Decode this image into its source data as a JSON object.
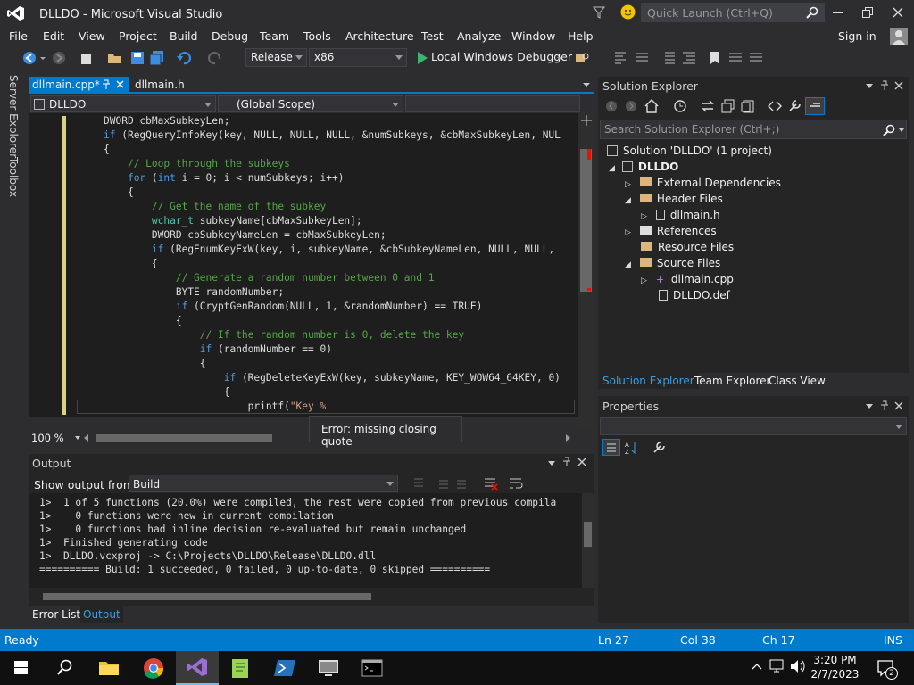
{
  "window": {
    "title": "DLLDO - Microsoft Visual Studio",
    "quick_launch_placeholder": "Quick Launch (Ctrl+Q)",
    "sign_in": "Sign in"
  },
  "menu": [
    "File",
    "Edit",
    "View",
    "Project",
    "Build",
    "Debug",
    "Team",
    "Tools",
    "Architecture",
    "Test",
    "Analyze",
    "Window",
    "Help"
  ],
  "toolbar": {
    "config": "Release",
    "platform": "x86",
    "debugger": "Local Windows Debugger"
  },
  "side_strip": [
    "Server Explorer",
    "Toolbox"
  ],
  "editor": {
    "tabs": [
      {
        "label": "dllmain.cpp*",
        "active": true
      },
      {
        "label": "dllmain.h",
        "active": false
      }
    ],
    "project_dropdown": "DLLDO",
    "scope_dropdown": "(Global Scope)",
    "zoom": "100 %",
    "tooltip": "Error: missing closing quote"
  },
  "code_lines": [
    "DWORD cbMaxSubkeyLen;",
    "if (RegQueryInfoKey(key, NULL, NULL, NULL, &numSubkeys, &cbMaxSubkeyLen, NUL",
    "{",
    "    // Loop through the subkeys",
    "    for (int i = 0; i < numSubkeys; i++)",
    "    {",
    "        // Get the name of the subkey",
    "        wchar_t subkeyName[cbMaxSubkeyLen];",
    "        DWORD cbSubkeyNameLen = cbMaxSubkeyLen;",
    "        if (RegEnumKeyExW(key, i, subkeyName, &cbSubkeyNameLen, NULL, NULL,",
    "        {",
    "            // Generate a random number between 0 and 1",
    "            BYTE randomNumber;",
    "            if (CryptGenRandom(NULL, 1, &randomNumber) == TRUE)",
    "            {",
    "                // If the random number is 0, delete the key",
    "                if (randomNumber == 0)",
    "                {",
    "                    if (RegDeleteKeyExW(key, subkeyName, KEY_WOW64_64KEY, 0)",
    "                    {",
    "                        printf(\"Key %"
  ],
  "output": {
    "title": "Output",
    "show_from_label": "Show output from:",
    "source": "Build",
    "lines": [
      "1>  1 of 5 functions (20.0%) were compiled, the rest were copied from previous compila",
      "1>    0 functions were new in current compilation",
      "1>    0 functions had inline decision re-evaluated but remain unchanged",
      "1>  Finished generating code",
      "1>  DLLDO.vcxproj -> C:\\Projects\\DLLDO\\Release\\DLLDO.dll",
      "========== Build: 1 succeeded, 0 failed, 0 up-to-date, 0 skipped =========="
    ],
    "tabs": [
      "Error List",
      "Output"
    ]
  },
  "solution_explorer": {
    "title": "Solution Explorer",
    "search_placeholder": "Search Solution Explorer (Ctrl+;)",
    "tree": [
      "Solution 'DLLDO' (1 project)",
      "DLLDO",
      "External Dependencies",
      "Header Files",
      "dllmain.h",
      "References",
      "Resource Files",
      "Source Files",
      "dllmain.cpp",
      "DLLDO.def"
    ],
    "tabs": [
      "Solution Explorer",
      "Team Explorer",
      "Class View"
    ]
  },
  "properties": {
    "title": "Properties"
  },
  "status": {
    "state": "Ready",
    "ln": "Ln 27",
    "col": "Col 38",
    "ch": "Ch 17",
    "mode": "INS"
  },
  "taskbar": {
    "time": "3:20 PM",
    "date": "2/7/2023",
    "notification_count": "2"
  },
  "colors": {
    "accent": "#007acc",
    "vs_purple": "#68217a",
    "comment": "#57a64a",
    "keyword": "#569cd6",
    "type": "#4ec9b0"
  }
}
